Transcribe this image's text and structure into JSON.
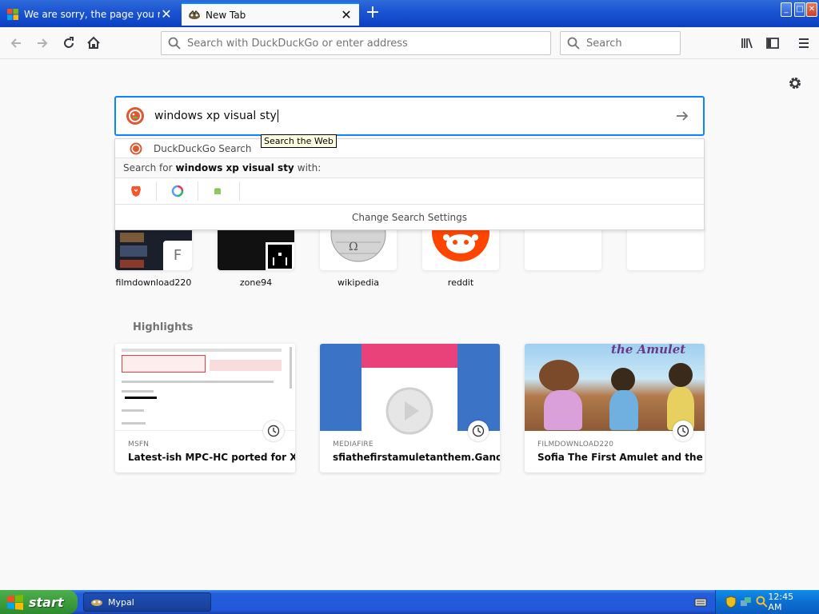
{
  "tabs": [
    {
      "title": "We are sorry, the page you reque",
      "close": "✕"
    },
    {
      "title": "New Tab",
      "close": "✕"
    }
  ],
  "new_tab_glyph": "+",
  "window_buttons": [
    "_",
    "□",
    "✕"
  ],
  "toolbar": {
    "url_placeholder": "Search with DuckDuckGo or enter address",
    "search_placeholder": "Search"
  },
  "search": {
    "query": "windows xp visual sty",
    "tooltip": "Search the Web",
    "suggestion": "DuckDuckGo Search",
    "search_for_prefix": "Search for",
    "search_for_query": "windows xp visual sty",
    "search_for_suffix": "with:",
    "engines": [
      "brave-icon",
      "qwant-icon",
      "mojeek-icon"
    ],
    "change_settings": "Change Search Settings"
  },
  "top_sites": [
    {
      "label": "filmdownload220",
      "letter": "F"
    },
    {
      "label": "zone94"
    },
    {
      "label": "wikipedia"
    },
    {
      "label": "reddit"
    },
    {
      "label": ""
    },
    {
      "label": ""
    }
  ],
  "highlights": {
    "title": "Highlights",
    "cards": [
      {
        "source": "MSFN",
        "title": "Latest-ish MPC-HC ported for X..."
      },
      {
        "source": "MEDIAFIRE",
        "title": "sfiathefirstamuletanthem.Gano..."
      },
      {
        "source": "FILMDOWNLOAD220",
        "title": "Sofia The First Amulet and the A...",
        "banner": "the Amulet"
      }
    ]
  },
  "taskbar": {
    "start_label": "start",
    "task_label": "Mypal",
    "clock": "12:45 AM"
  },
  "colors": {
    "accent": "#0a84ff",
    "xp_blue": "#245edb",
    "start_green": "#3a9a3a",
    "reddit_orange": "#ff4500",
    "ddg_orange": "#de5833"
  }
}
